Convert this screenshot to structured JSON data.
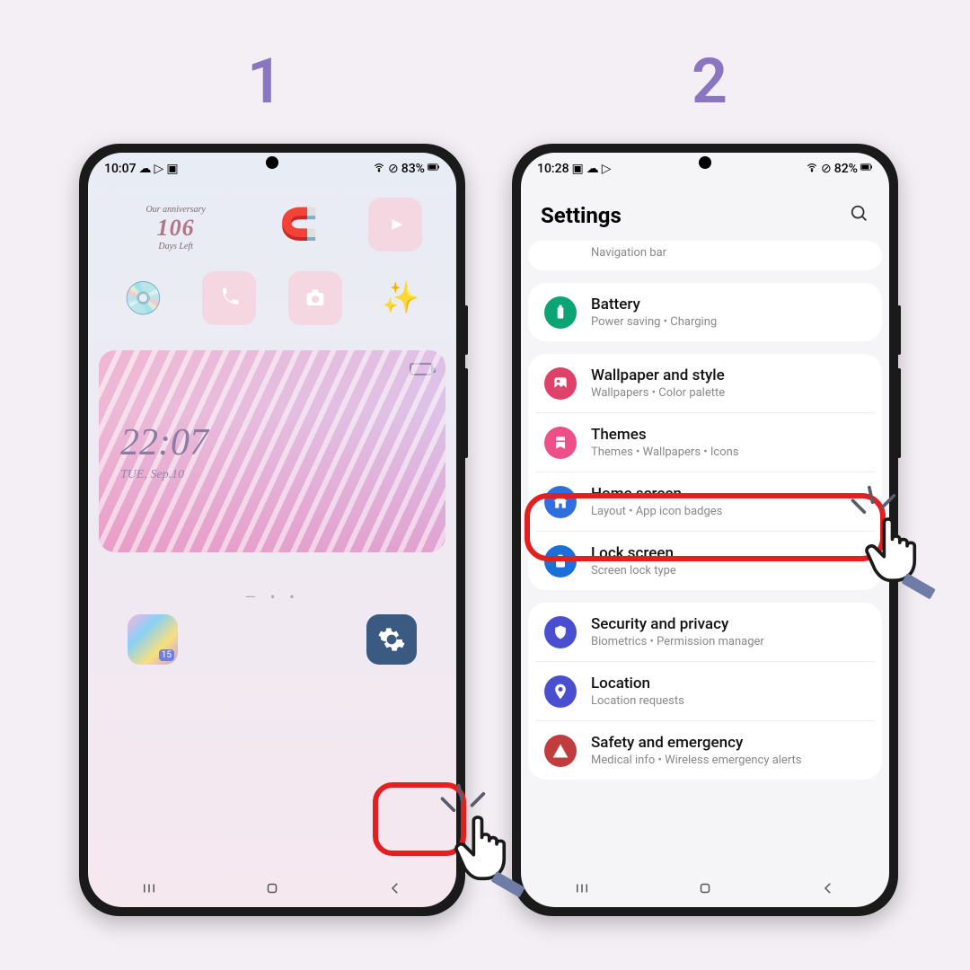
{
  "steps": {
    "one": "1",
    "two": "2"
  },
  "phone1": {
    "status": {
      "time": "10:07",
      "battery": "83%"
    },
    "widget": {
      "top": "Our anniversary",
      "num": "106",
      "bottom": "Days Left"
    },
    "hero": {
      "time": "22:07",
      "date": "TUE, Sep.10"
    },
    "pagedots": "— • •"
  },
  "phone2": {
    "status": {
      "time": "10:28",
      "battery": "82%"
    },
    "title": "Settings",
    "cutoff": "Navigation bar",
    "groups": [
      {
        "items": [
          {
            "icon": "battery",
            "color": "#0ba574",
            "title": "Battery",
            "sub": "Power saving  •  Charging"
          }
        ]
      },
      {
        "items": [
          {
            "icon": "wallpaper",
            "color": "#e04169",
            "title": "Wallpaper and style",
            "sub": "Wallpapers  •  Color palette"
          },
          {
            "icon": "themes",
            "color": "#ef4f87",
            "title": "Themes",
            "sub": "Themes  •  Wallpapers  •  Icons"
          },
          {
            "icon": "home",
            "color": "#2d6fe0",
            "title": "Home screen",
            "sub": "Layout  •  App icon badges",
            "highlight": true
          },
          {
            "icon": "lock",
            "color": "#1b6fd8",
            "title": "Lock screen",
            "sub": "Screen lock type"
          }
        ]
      },
      {
        "items": [
          {
            "icon": "shield",
            "color": "#4a4fcf",
            "title": "Security and privacy",
            "sub": "Biometrics  •  Permission manager"
          },
          {
            "icon": "pin",
            "color": "#4a4fcf",
            "title": "Location",
            "sub": "Location requests"
          },
          {
            "icon": "alert",
            "color": "#c13c3c",
            "title": "Safety and emergency",
            "sub": "Medical info  •  Wireless emergency alerts"
          }
        ]
      }
    ]
  }
}
